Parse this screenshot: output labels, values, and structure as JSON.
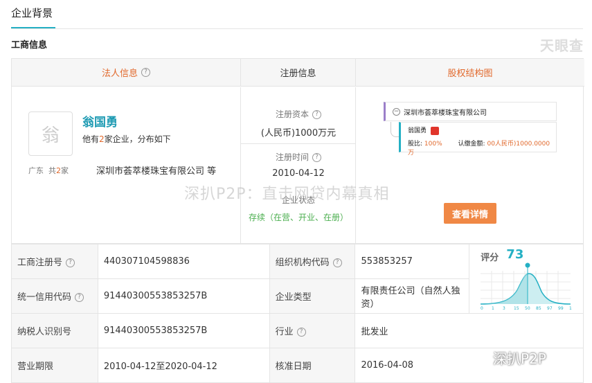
{
  "tabs": {
    "active": "企业背景"
  },
  "section": {
    "title": "工商信息",
    "logo_text": "天眼查"
  },
  "panel": {
    "headers": {
      "legal": "法人信息",
      "registration": "注册信息",
      "equity": "股权结构图"
    },
    "legal": {
      "avatar_char": "翁",
      "name": "翁国勇",
      "desc_prefix": "他有",
      "desc_count": "2",
      "desc_suffix": "家企业，分布如下",
      "region": "广东",
      "region_total_prefix": "共",
      "region_total_count": "2",
      "region_total_suffix": "家",
      "company": "深圳市荟萃楼珠宝有限公司 等"
    },
    "registration": {
      "capital_label": "注册资本",
      "capital_value": "(人民币)1000万元",
      "date_label": "注册时间",
      "date_value": "2010-04-12",
      "status_label": "企业状态",
      "status_value": "存续（在营、开业、在册）"
    },
    "equity": {
      "root_company": "深圳市荟萃楼珠宝有限公司",
      "holder_name": "翁国勇",
      "ratio_label": "股比:",
      "ratio_value": "100%",
      "subscribed_label": "认缴金额:",
      "subscribed_value": "00人民币)1000.0000万",
      "detail_button": "查看详情"
    }
  },
  "watermark": "深扒P2P：直击网贷内幕真相",
  "info_table": {
    "reg_no_label": "工商注册号",
    "reg_no": "440307104598836",
    "org_code_label": "组织机构代码",
    "org_code": "553853257",
    "credit_code_label": "统一信用代码",
    "credit_code": "91440300553853257B",
    "company_type_label": "企业类型",
    "company_type": "有限责任公司（自然人独资）",
    "taxpayer_label": "纳税人识别号",
    "taxpayer": "91440300553853257B",
    "industry_label": "行业",
    "industry": "批发业",
    "term_label": "营业期限",
    "term": "2010-04-12至2020-04-12",
    "approval_label": "核准日期",
    "approval": "2016-04-08"
  },
  "score": {
    "label": "评分",
    "value": "73",
    "ticks": [
      "0",
      "1",
      "3",
      "15",
      "50",
      "85",
      "97",
      "99",
      "100"
    ]
  },
  "wechat_watermark": "深扒P2P"
}
